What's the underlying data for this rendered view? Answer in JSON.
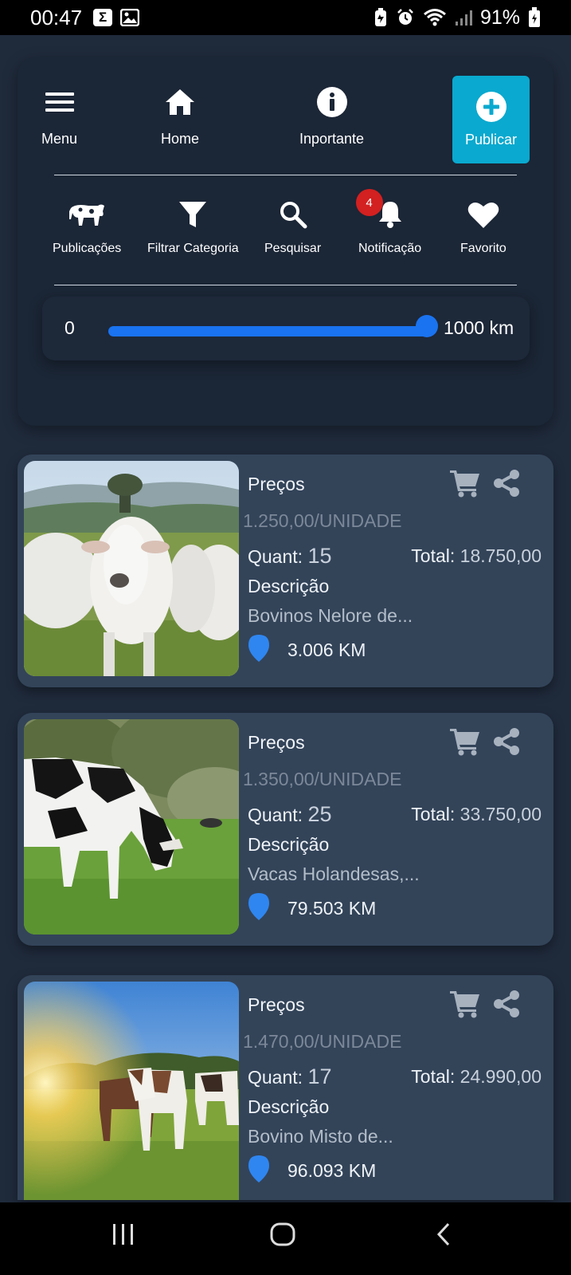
{
  "status_bar": {
    "time": "00:47",
    "battery": "91%"
  },
  "toolbar": {
    "menu_label": "Menu",
    "home_label": "Home",
    "importante_label": "Inportante",
    "publicar_label": "Publicar",
    "accent": "#0aa9cf"
  },
  "subnav": {
    "publicacoes_label": "Publicações",
    "filtrar_label": "Filtrar Categoria",
    "pesquisar_label": "Pesquisar",
    "notificacao_label": "Notificação",
    "notificacao_count": "4",
    "favorito_label": "Favorito"
  },
  "distance_slider": {
    "min_label": "0",
    "max_label": "1000 km",
    "value_fraction": 1.0,
    "color": "#1a73f0"
  },
  "listings": [
    {
      "precos_label": "Preços",
      "price": "1.250,00/UNIDADE",
      "quant_label": "Quant:",
      "quant": "15",
      "total_label": "Total:",
      "total": "18.750,00",
      "descricao_label": "Descrição",
      "descricao": "Bovinos Nelore de...",
      "distance": "3.006 KM",
      "image": "white-nelore-cattle"
    },
    {
      "precos_label": "Preços",
      "price": "1.350,00/UNIDADE",
      "quant_label": "Quant:",
      "quant": "25",
      "total_label": "Total:",
      "total": "33.750,00",
      "descricao_label": "Descrição",
      "descricao": "Vacas Holandesas,...",
      "distance": "79.503 KM",
      "image": "holstein-cow-grazing"
    },
    {
      "precos_label": "Preços",
      "price": "1.470,00/UNIDADE",
      "quant_label": "Quant:",
      "quant": "17",
      "total_label": "Total:",
      "total": "24.990,00",
      "descricao_label": "Descrição",
      "descricao": "Bovino Misto de...",
      "distance": "96.093 KM",
      "image": "mixed-cattle-sunset"
    }
  ]
}
